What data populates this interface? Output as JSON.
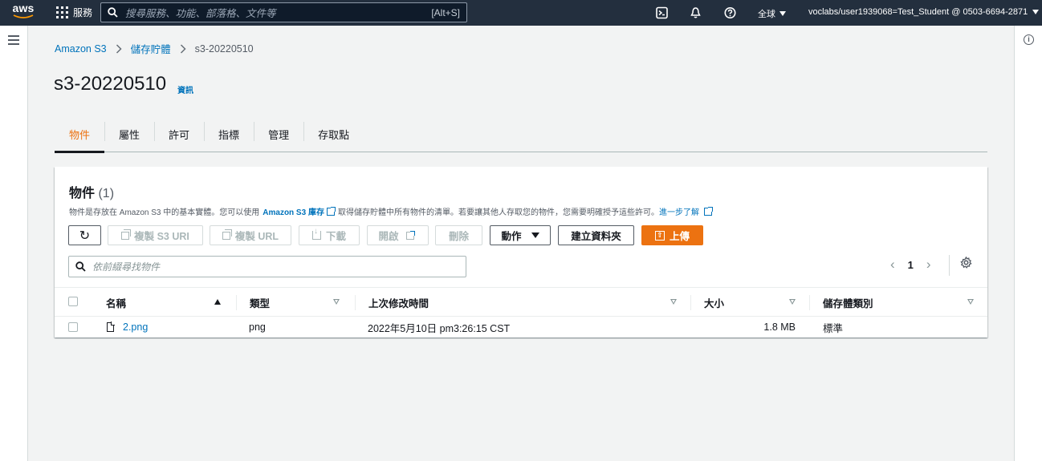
{
  "topnav": {
    "logo": "aws",
    "services_label": "服務",
    "search_placeholder": "搜尋服務、功能、部落格、文件等",
    "search_shortcut": "[Alt+S]",
    "region": "全球",
    "account": "voclabs/user1939068=Test_Student @ 0503-6694-2871",
    "icons": [
      "cloudshell-icon",
      "bell-icon",
      "help-icon"
    ]
  },
  "breadcrumb": [
    "Amazon S3",
    "儲存貯體",
    "s3-20220510"
  ],
  "page": {
    "title": "s3-20220510",
    "info": "資訊"
  },
  "tabs": [
    "物件",
    "屬性",
    "許可",
    "指標",
    "管理",
    "存取點"
  ],
  "active_tab": 0,
  "objects": {
    "title": "物件",
    "count": "(1)",
    "desc_1": "物件是存放在 Amazon S3 中的基本實體。您可以使用",
    "desc_link": "Amazon S3 庫存",
    "desc_2": "取得儲存貯體中所有物件的清單。若要讓其他人存取您的物件，您需要明確授予這些許可。",
    "desc_learn": "進一步了解",
    "buttons": {
      "copy_s3_uri": "複製 S3 URI",
      "copy_url": "複製 URL",
      "download": "下載",
      "open": "開啟",
      "delete": "刪除",
      "actions": "動作",
      "create_folder": "建立資料夾",
      "upload": "上傳"
    },
    "filter_placeholder": "依前綴尋找物件",
    "page_number": "1",
    "columns": [
      "名稱",
      "類型",
      "上次修改時間",
      "大小",
      "儲存體類別"
    ],
    "rows": [
      {
        "name": "2.png",
        "type": "png",
        "modified": "2022年5月10日 pm3:26:15 CST",
        "size": "1.8 MB",
        "storage": "標準"
      }
    ]
  },
  "colors": {
    "nav_bg": "#232f3e",
    "accent": "#ec7211",
    "link": "#0073bb"
  }
}
